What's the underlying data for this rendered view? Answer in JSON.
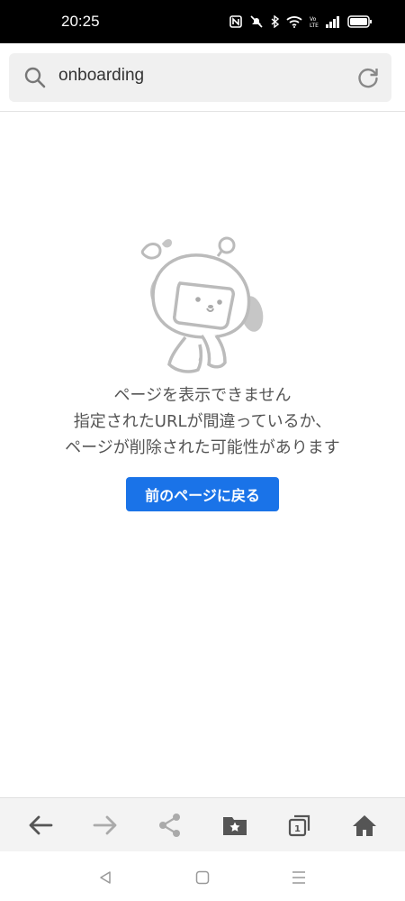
{
  "status_bar": {
    "time": "20:25",
    "icons": [
      "nfc-icon",
      "mute-icon",
      "bluetooth-icon",
      "wifi-icon",
      "volte-icon",
      "signal-icon",
      "battery-icon"
    ]
  },
  "search": {
    "query": "onboarding",
    "icon": "search-icon",
    "reload_icon": "reload-icon"
  },
  "error_page": {
    "illustration": "robot-mascot-icon",
    "lines": [
      "ページを表示できません",
      "指定されたURLが間違っているか、",
      "ページが削除された可能性があります"
    ],
    "button_label": "前のページに戻る",
    "button_color": "#1a73e8"
  },
  "toolbar": {
    "items": [
      "back-icon",
      "forward-icon",
      "share-icon",
      "bookmarks-icon",
      "tabs-icon",
      "home-icon"
    ],
    "tab_count": "1"
  },
  "system_nav": {
    "items": [
      "nav-back-icon",
      "nav-home-icon",
      "nav-recents-icon"
    ]
  }
}
